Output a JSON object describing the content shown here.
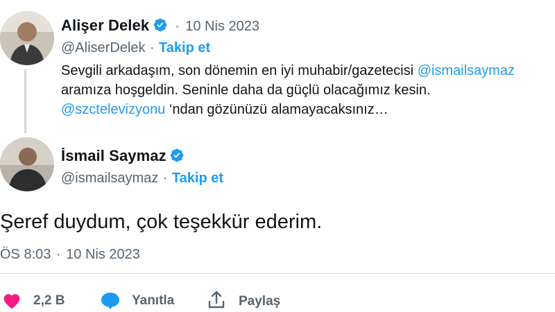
{
  "tweet1": {
    "name": "Alişer Delek",
    "dot": "·",
    "date": "10 Nis 2023",
    "handle": "@AliserDelek",
    "follow": "Takip et",
    "text": {
      "line1": "Sevgili arkadaşım, son dönemin en iyi muhabir/gazetecisi ",
      "mention1": "@ismailsaymaz",
      "line2": "aramıza hoşgeldin. Seninle daha da güçlü olacağımız kesin.",
      "mention2": "@szctelevizyonu",
      "line3": " ‘ndan gözünüzü alamayacaksınız…"
    }
  },
  "tweet2": {
    "name": "İsmail Saymaz",
    "handle": "@ismailsaymaz",
    "dot": "·",
    "follow": "Takip et",
    "text": "Şeref duydum, çok teşekkür ederim.",
    "time": "ÖS 8:03",
    "date": "10 Nis 2023"
  },
  "actions": {
    "likes": "2,2 B",
    "reply": "Yanıtla",
    "share": "Paylaş"
  },
  "colors": {
    "accent": "#1d9bf0",
    "like": "#f91880",
    "muted": "#536471"
  }
}
